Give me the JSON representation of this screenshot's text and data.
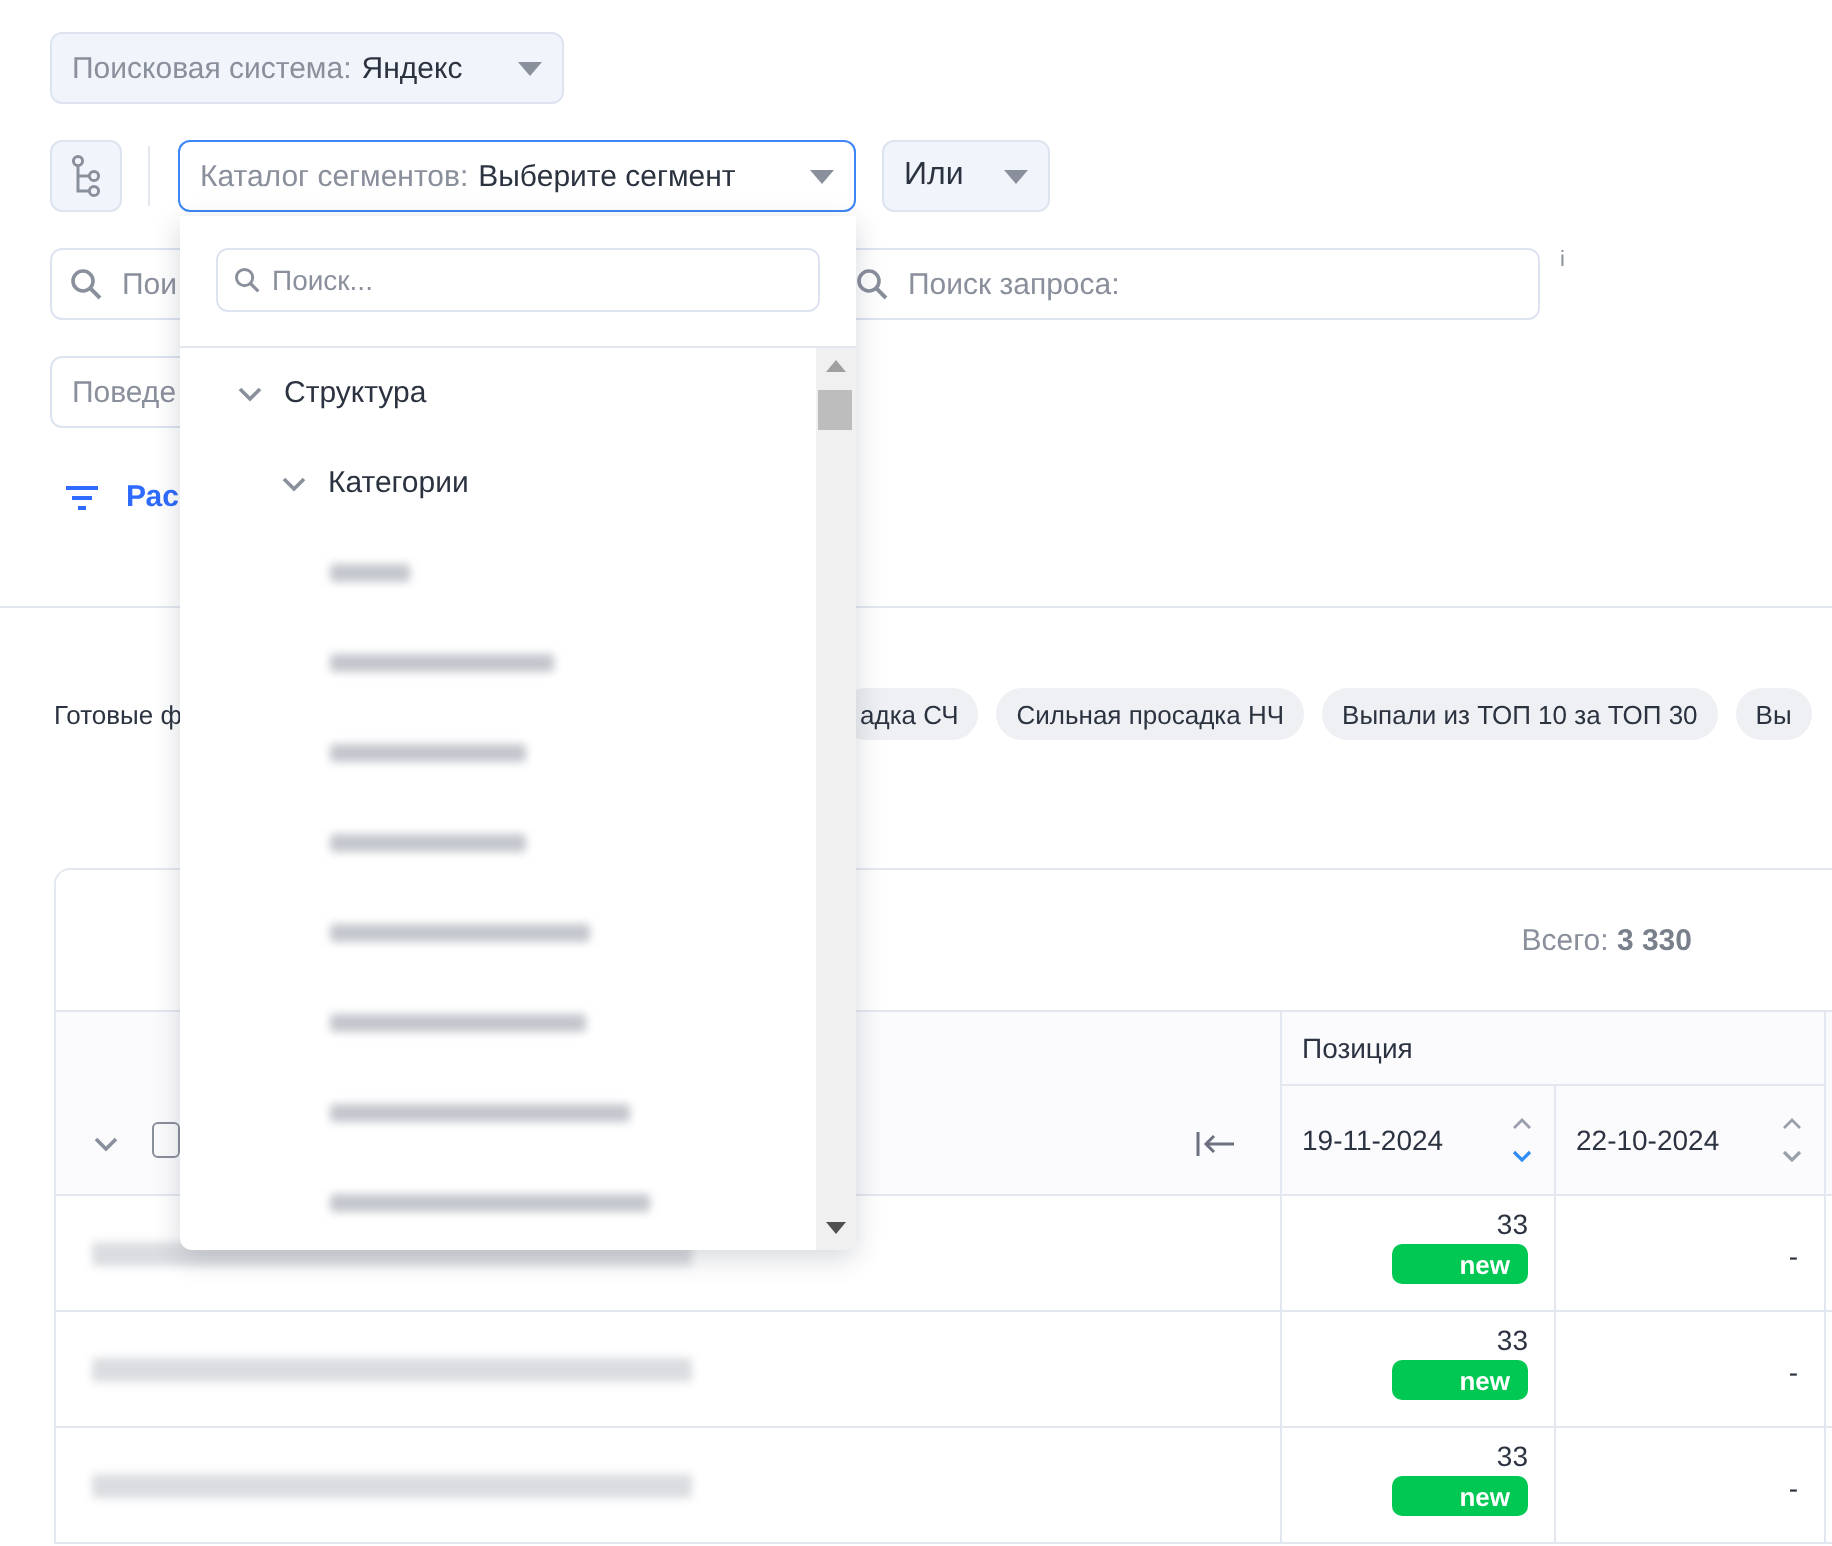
{
  "search_engine": {
    "label": "Поисковая система:",
    "value": "Яндекс"
  },
  "segment_select": {
    "label": "Каталог сегментов:",
    "value": "Выберите сегмент",
    "open": true
  },
  "logic_select": {
    "value": "Или"
  },
  "search_fields": [
    {
      "placeholder": "Пои"
    },
    {
      "placeholder": "Поиск запроса:"
    }
  ],
  "info_mark": "i",
  "behavior_field": {
    "placeholder": "Поведе"
  },
  "filter_link": "Рас",
  "presets": {
    "label": "Готовые ф",
    "chips": [
      "адка СЧ",
      "Сильная просадка НЧ",
      "Выпали из ТОП 10 за ТОП 30",
      "Вы"
    ]
  },
  "table": {
    "total": "Всего: **3 330**",
    "group_header": "Позиция",
    "header_checkbox": {
      "checked": false
    },
    "columns": [
      {
        "label": "19-11-2024",
        "sorted": true
      },
      {
        "label": "22-10-2024",
        "sorted": false
      }
    ],
    "rows": [
      {
        "kind": "blurred",
        "cells": [
          {
            "value": "33",
            "badge": "new"
          },
          {
            "value": "-"
          }
        ]
      },
      {
        "kind": "blurred",
        "cells": [
          {
            "value": "33",
            "badge": "new"
          },
          {
            "value": "-"
          }
        ]
      },
      {
        "kind": "blurred",
        "cells": [
          {
            "value": "33",
            "badge": "new"
          },
          {
            "value": "-"
          }
        ]
      }
    ]
  },
  "segment_dropdown": {
    "search_placeholder": "Поиск...",
    "tree": [
      {
        "label": "Структура",
        "expanded": true,
        "children": [
          {
            "label": "Категории",
            "expanded": true,
            "children": [
              {
                "kind": "blurred"
              },
              {
                "kind": "blurred"
              },
              {
                "kind": "blurred"
              },
              {
                "kind": "blurred"
              },
              {
                "kind": "blurred"
              },
              {
                "kind": "blurred"
              },
              {
                "kind": "blurred"
              },
              {
                "kind": "blurred"
              }
            ]
          }
        ]
      }
    ]
  }
}
